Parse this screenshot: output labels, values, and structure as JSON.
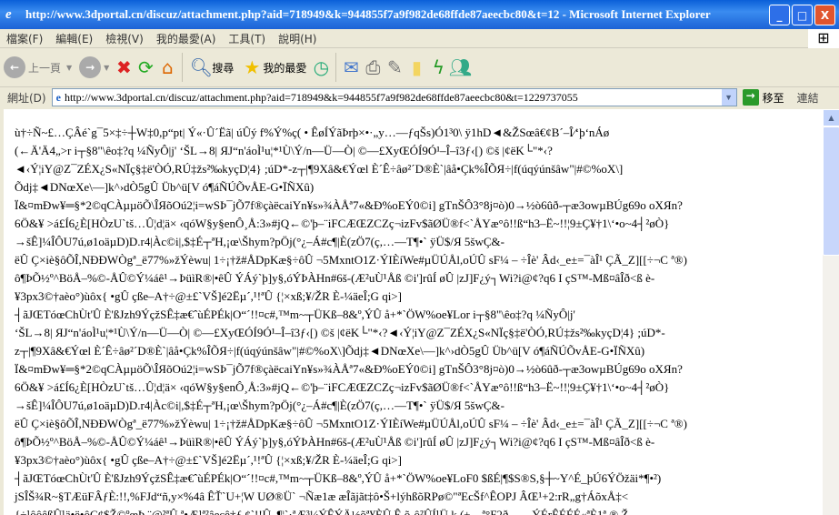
{
  "window": {
    "title": "http://www.3dportal.cn/discuz/attachment.php?aid=718949&k=944855f7a9f982de68ffde87aeecbc80&t=12 - Microsoft Internet Explorer",
    "minimize": "_",
    "maximize": "□",
    "close": "X"
  },
  "menu": [
    "檔案(F)",
    "編輯(E)",
    "檢視(V)",
    "我的最愛(A)",
    "工具(T)",
    "說明(H)"
  ],
  "toolbar": {
    "back": "上一頁",
    "search": "搜尋",
    "favorites": "我的最愛"
  },
  "address": {
    "label": "網址(D)",
    "url": "http://www.3dportal.cn/discuz/attachment.php?aid=718949&k=944855f7a9f982de68ffde87aeecbc80&t=1229737055",
    "go": "移至",
    "links": "連結"
  },
  "content": {
    "lines": [
      "ù†÷Ñ~£…ÇÂé`g¯5×‡÷┼W‡0,p“pt| Ý«·Û´Ëã| úÛý f%Ý%ç(  • ÊøÍÝãÞrþ×•·„y…—ƒqŠs)Ó1³0\\ ÿ1hD◄&ŽSœâ€¢B´–Î⁄‘þ‘nÁø",
      "(←Ä'Ä4„>r  i┬§8\"\\êo‡?q ¼ÑyÔ|j' ‘ŠL→8| ЯJ“n'áoÌ¹u¦*¹Ù\\Ý/n—Ü—Ò| ©—£XyŒÓÍ9Ó¹–Î–î3ƒ‹[) ©š  |¢ëK└\"*‹?",
      "◄‹Ý¦iY@Z¯ZÉX¿S«NÏç§‡ë'ÒÓ,RÚ‡žs²‰kyçD¦4} ;úD*-z┬|¶9Xâ&€Ýœl  È´Ê÷âø²´D®È`|âå•Çk%ÎÕЯ÷|f(úqýúnšâw\"|#©%oX\\]",
      "Õdj‡◄DNœXe\\—]k^›dÒ5gÛ  Üb^ü[V  ó¶áÑÚÕvÅE-G•ÏÑXû)",
      " Ï&¤mÐw¥═§*2©qCÀµµöÕ\\ÎЯõOú2¦i=wSÞ¯jÕ7f®çàëcaiYn¥s»¾ÀÅª7«&Ð%oEÝ0©i] gTnŠÔ3°8j¤ò)0→½ò6ûð-┬æ3owµBÚg69o  oXЯn?",
      "6Ö&¥ >á£Í6¿È[HÒzU`tš…Û¦d¦ä× ‹qóW§y§enÔ¸Å:3»#jQ←©'þ–¨iFCÆŒZCZç¬izFv$ãØÜ®f<`ÅYæ°ô!!ß“h3–Ë~!!¦9±Ç¥†1\\‘•o~4┤²øÒ}",
      "→šÊ]¼ÎÔU7ú,ø1oäµD)D.r4|Àc©i|,$‡É┬ªH,¡œ\\Šhym?pÖj(°¿–Á#c¶|È(zÖ7(ç,…—T¶•` ÿÜ$/Я 5šwÇ&-",
      "ëÛ  Ç×iè§ôÕÎ,NÐÐWÒgª_ë77%»žÝèwu| 1÷¡†ž#ÅDpKæ§÷ôÛ ¬5MxntO1Z·ÝIÈíWe#µÜÚÅl,oÚÛ sF¼ – ÷Îè'  Âd‹_e±=¯àÎ¹ ÇÃ_Z][[÷¬C ª®)",
      "ô¶ÞÕ½º^BöÅ–%©-ÅÛ©Ý¼áê¹→ÞüìR®|•êÛ  ÝÁý`þ]y§,óÝÞÀHn#6š-(Æ²uÙ¹Åß ©i']rûÍ  øÛ |zJ]F¿ý┐Wi?i@¢?q6  I çS™-Mß¤âÎð<ß è-",
      "¥3px3©†aèo°)ùôx{  •gÛ çße–A†÷@±£`VŠ]é2Ëµ´,¹!ªÛ  {¦×xß;¥/ŽR È-¼äeÎ;G qi>]",
      "┤ãJŒTóœChÙt'Û  È'ßJzh9ÝçžSÊ‡æ€ˆùÉPÉk|O“´!!¤c#,™m~┬ÜKß–8&º,ÝÛ  å+*`ÖW%oe¥Lor  i┬§8\"\\êo‡?q ¼ÑyÔ|j'",
      "‘ŠL→8| ЯJ“n'áoÌ¹u¦*¹Ù\\Ý/n—Ü—Ò| ©—£XyŒÓÍ9Ó¹–Î–î3ƒ‹[) ©š  |¢ëK└\"*‹?◄‹Ý¦iY@Z¯ZÉX¿S«NÏç§‡ë'ÒÓ,RÚ‡žs²‰kyçD¦4} ;úD*-",
      "z┬|¶9Xâ&€Ýœl  È´Ê÷âø²´D®È`|âå•Çk%ÎÕЯ÷|f(úqýúnšâw\"|#©%oX\\]Õdj‡◄DNœXe\\—]k^›dÒ5gÛ  Üb^ü[V  ó¶áÑÚÕvÅE-G•ÏÑXû)",
      " Ï&¤mÐw¥═§*2©qCÀµµöÕ\\ÎЯõOú2¦i=wSÞ¯jÕ7f®çàëcaiYn¥s»¾ÀÅª7«&Ð%oEÝ0©i] gTnŠÔ3°8j¤ò)0→½ò6ûð-┬æ3owµBÚg69o  oXЯn?",
      "6Ö&¥ >á£Í6¿È[HÒzU`tš…Û¦d¦ä× ‹qóW§y§enÔ¸Å:3»#jQ←©'þ–¨iFCÆŒZCZç¬izFv$ãØÜ®f<`ÅYæ°ô!!ß“h3–Ë~!!¦9±Ç¥†1\\‘•o~4┤²øÒ}",
      "→šÊ]¼ÎÔU7ú,ø1oäµD)D.r4|Àc©i|,$‡É┬ªH,¡œ\\Šhym?pÖj(°¿–Á#c¶|È(zÖ7(ç,…—T¶•` ÿÜ$/Я 5šwÇ&-",
      "ëÛ  Ç×iè§ôÕÎ,NÐÐWÒgª_ë77%»žÝèwu| 1÷¡†ž#ÅDpKæ§÷ôÛ ¬5MxntO1Z·ÝIÈíWe#µÜÚÅl,oÚÛ sF¼ – ÷Îè'  Âd‹_e±=¯àÎ¹ ÇÃ_Z][[÷¬C ª®)",
      "ô¶ÞÕ½º^BöÅ–%©-ÅÛ©Ý¼áê¹→ÞüìR®|•êÛ  ÝÁý`þ]y§,óÝÞÀHn#6š-(Æ²uÙ¹Åß ©i']rûÍ  øÛ |zJ]F¿ý┐Wi?i@¢?q6  I çS™-Mß¤âÎð<ß è-",
      "¥3px3©†aèo°)ùôx{  •gÛ çße–A†÷@±£`VŠ]é2Ëµ´,¹!ªÛ  {¦×xß;¥/ŽR È-¼äeÎ;G qi>]",
      "┤ãJŒTóœChÙt'Û  È'ßJzh9ÝçžSÊ‡æ€ˆùÉPÉk|O“´!!¤c#,™m~┬ÜKß–8&º,ÝÛ  å+*`ÖW%oe¥LoF0  $ßÉ|¶$S®S,§┼~Y^É_þÚ6ÝÖžäi*¶•²)",
      "jSÎŠ¾R~§TÆüFÂƒÈ:!!,%FJd“ñ,y×%4â  ÊŤ`U+¦W  UØ®Ü`  ¬Ñæ1æ æÎãjãt‡ô•Š+lýhßõRPø©\"ªEcŠf^ÊOPJ  ÂŒ¹+2:rR„g†ÁõxÅ‡<",
      "{÷¹ôôêßÛ¹ä•ë•ôÇ¢$Ž©ºœÞ ¨@²ªÛ ª•Æ¹ª²âeçê†ƒ.¢`!!Û  .¶¦`·ªÆ³¼ÝÊÝÄ½õª¥ÈÛ  Ê  õ¸ô²ÛÍ¹Ü  k (±▬ª°F2ð——ÝÉrÊÉÉÉ«ªÈ1ª.®  Ž"
    ]
  }
}
